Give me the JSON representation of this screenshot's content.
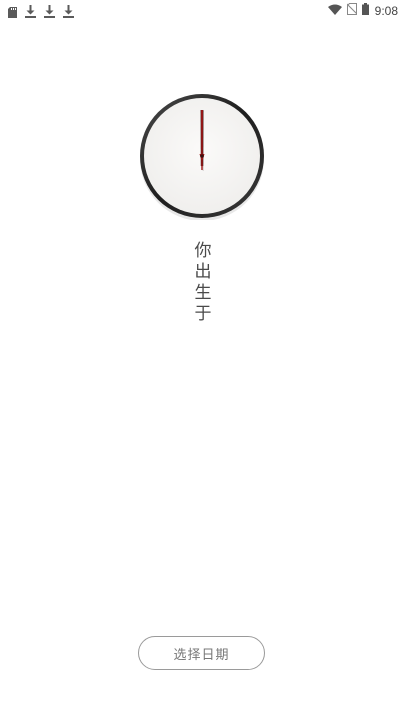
{
  "status_bar": {
    "time": "9:08",
    "left_icons": [
      "sd-card-icon",
      "download-icon",
      "download-icon",
      "download-icon"
    ],
    "right_icons": [
      "wifi-icon",
      "no-sim-icon",
      "battery-icon"
    ]
  },
  "clock": {
    "face_color": "#f6f5f4",
    "rim_color": "#2a2a2a",
    "hand_color": "#a01818"
  },
  "headline": {
    "chars": [
      "你",
      "出",
      "生",
      "于"
    ]
  },
  "select_date_button": {
    "label": "选择日期"
  }
}
